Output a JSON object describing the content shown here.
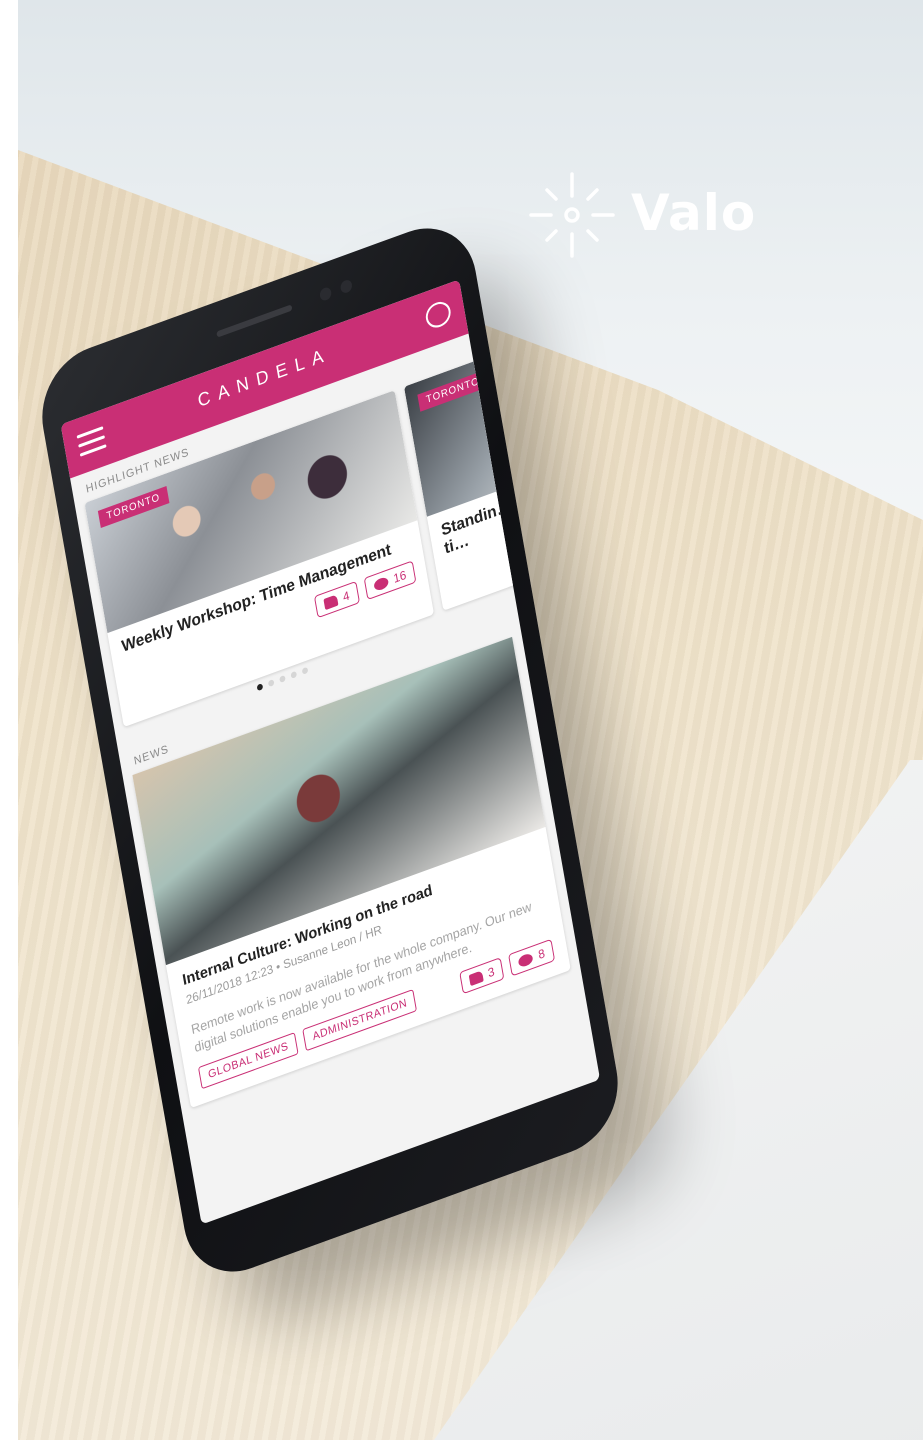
{
  "brand": {
    "name": "Valo"
  },
  "app": {
    "title": "CANDELA",
    "highlight_label": "HIGHLIGHT NEWS",
    "news_label": "NEWS",
    "highlight_cards": [
      {
        "tag": "TORONTO",
        "title": "Weekly Workshop: Time Management",
        "likes": "4",
        "comments": "16"
      },
      {
        "tag": "TORONTO",
        "title": "Standin… to cut ti…"
      }
    ],
    "carousel": {
      "active_index": 0,
      "count": 5
    },
    "news": {
      "title": "Internal Culture: Working on the road",
      "meta": "26/11/2018 12:23 • Susanne Leon / HR",
      "excerpt": "Remote work is now available for the whole company. Our new digital solutions enable you to work from anywhere.",
      "tags": [
        "GLOBAL NEWS",
        "ADMINISTRATION"
      ],
      "likes": "3",
      "comments": "8"
    }
  },
  "colors": {
    "accent": "#c92f75",
    "logo": "#ffffff"
  },
  "icons": [
    "menu-icon",
    "chat-icon",
    "thumbs-up-icon",
    "comment-icon",
    "sun-logo-icon"
  ]
}
